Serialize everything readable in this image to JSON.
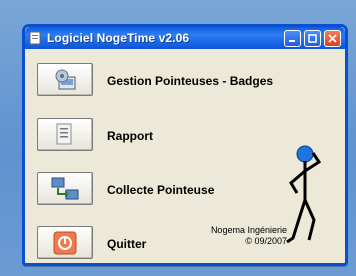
{
  "window": {
    "title": "Logiciel NogeTime v2.06"
  },
  "menu": {
    "items": [
      {
        "label": "Gestion Pointeuses - Badges",
        "icon": "badge-management-icon"
      },
      {
        "label": "Rapport",
        "icon": "report-icon"
      },
      {
        "label": "Collecte Pointeuse",
        "icon": "network-collect-icon"
      },
      {
        "label": "Quitter",
        "icon": "power-icon"
      }
    ]
  },
  "footer": {
    "company": "Nogema Ingénierie",
    "copyright": "© 09/2007"
  },
  "colors": {
    "titlebar": "#0b5fe0",
    "window_bg": "#ece9d8",
    "desktop": "#6f9fd6"
  }
}
